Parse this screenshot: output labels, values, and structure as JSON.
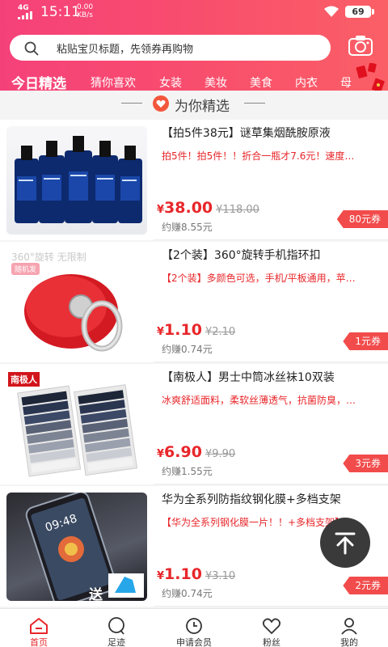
{
  "status_bar": {
    "network": "4G",
    "time": "15:11",
    "speed_value": "0.00",
    "speed_unit": "KB/s",
    "battery": "69"
  },
  "search": {
    "placeholder": "粘贴宝贝标题，先领券再购物"
  },
  "tabs": [
    "今日精选",
    "猜你喜欢",
    "女装",
    "美妆",
    "美食",
    "内衣",
    "母"
  ],
  "section_title": "为你精选",
  "products": [
    {
      "title": "【拍5件38元】谜草集烟酰胺原液",
      "desc": "拍5件！拍5件！！折合一瓶才7.6元！速度…",
      "price": "38.00",
      "original": "¥118.00",
      "earn": "约赚8.55元",
      "coupon": "80元券",
      "image": "hyaluronic-acid-bottles"
    },
    {
      "title": "【2个装】360°旋转手机指环扣",
      "desc": "【2个装】多颜色可选，手机/平板通用，苹…",
      "price": "1.10",
      "original": "¥2.10",
      "earn": "约赚0.74元",
      "coupon": "1元券",
      "image": "red-phone-ring-holder",
      "overlay": "360°旋转 无限制",
      "badge": "随机发"
    },
    {
      "title": "【南极人】男士中筒冰丝袜10双装",
      "desc": "冰爽舒适面料，柔软丝薄透气，抗菌防臭，…",
      "price": "6.90",
      "original": "¥9.90",
      "earn": "约赚1.55元",
      "coupon": "3元券",
      "image": "socks-boxes",
      "overlay": "南极人"
    },
    {
      "title": "华为全系列防指纹钢化膜+多档支架",
      "desc": "【华为全系列钢化膜一片！！+多档支架】…",
      "price": "1.10",
      "original": "¥3.10",
      "earn": "约赚0.74元",
      "coupon": "2元券",
      "image": "phone-screen-protector",
      "overlay": "送"
    }
  ],
  "currency_symbol": "¥",
  "bottom_nav": [
    {
      "label": "首页",
      "icon": "home-icon",
      "active": true
    },
    {
      "label": "足迹",
      "icon": "footprint-icon",
      "active": false
    },
    {
      "label": "申请会员",
      "icon": "clock-icon",
      "active": false
    },
    {
      "label": "粉丝",
      "icon": "heart-icon",
      "active": false
    },
    {
      "label": "我的",
      "icon": "person-icon",
      "active": false
    }
  ],
  "colors": {
    "header_start": "#f5417a",
    "header_end": "#fb5f66",
    "price_red": "#e8262a",
    "coupon_red": "#f24b4b"
  }
}
